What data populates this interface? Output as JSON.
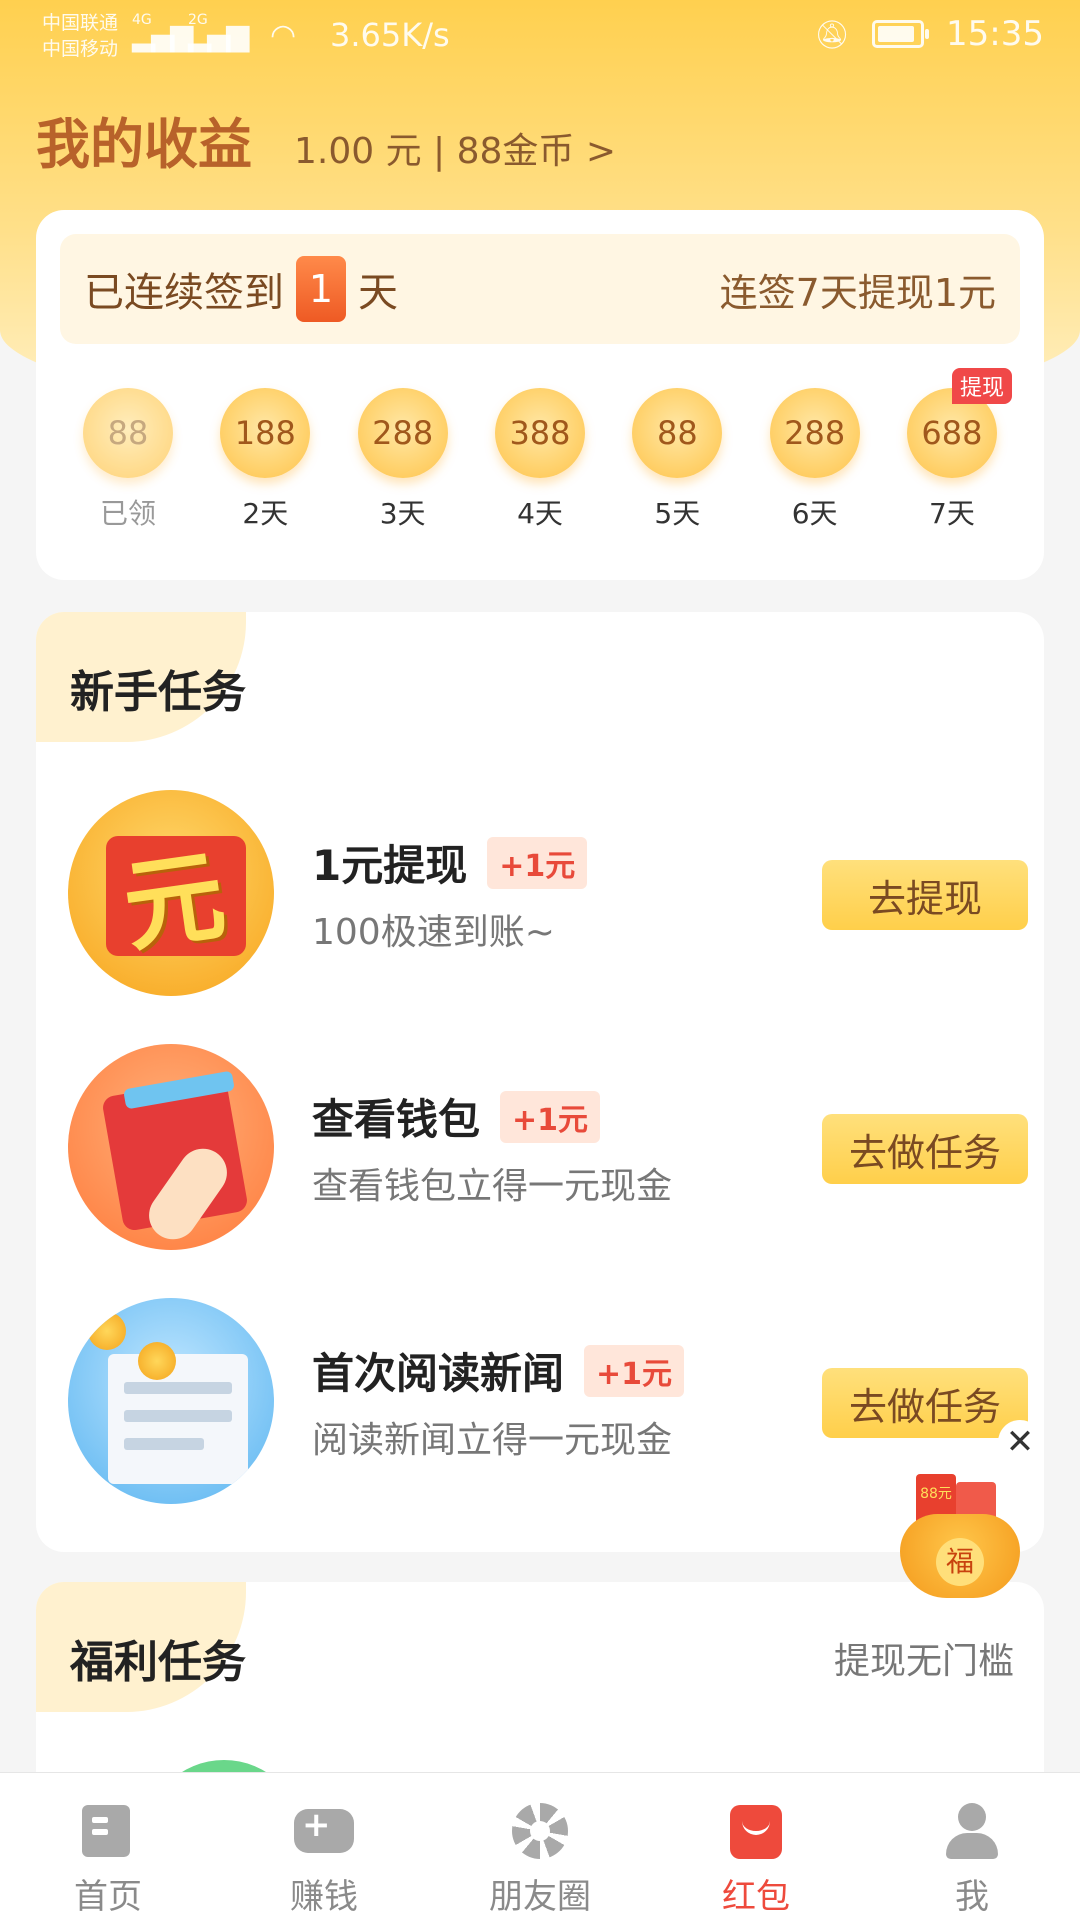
{
  "status_bar": {
    "carrier_1": "中国联通",
    "carrier_2": "中国移动",
    "signal_1_type": "4G",
    "signal_2_type": "2G",
    "speed": "3.65K/s",
    "time": "15:35",
    "icons": [
      "signal-icon",
      "wifi-icon",
      "mute-icon",
      "battery-icon"
    ]
  },
  "header": {
    "title": "我的收益",
    "earnings": "1.00 元 | 88金币 >"
  },
  "checkin": {
    "prefix": "已连续签到",
    "days": "1",
    "suffix": "天",
    "goal": "连签7天提现1元",
    "withdraw_tag": "提现",
    "days_list": [
      {
        "coins": "88",
        "label": "已领",
        "claimed": true
      },
      {
        "coins": "188",
        "label": "2天",
        "claimed": false
      },
      {
        "coins": "288",
        "label": "3天",
        "claimed": false
      },
      {
        "coins": "388",
        "label": "4天",
        "claimed": false
      },
      {
        "coins": "88",
        "label": "5天",
        "claimed": false
      },
      {
        "coins": "288",
        "label": "6天",
        "claimed": false
      },
      {
        "coins": "688",
        "label": "7天",
        "claimed": false
      }
    ]
  },
  "newbie_tasks": {
    "title": "新手任务",
    "items": [
      {
        "title": "1元提现",
        "reward": "+1元",
        "desc": "100极速到账~",
        "button": "去提现",
        "icon": "yuan-envelope-icon",
        "icon_glyph": "元"
      },
      {
        "title": "查看钱包",
        "reward": "+1元",
        "desc": "查看钱包立得一元现金",
        "button": "去做任务",
        "icon": "wallet-icon"
      },
      {
        "title": "首次阅读新闻",
        "reward": "+1元",
        "desc": "阅读新闻立得一元现金",
        "button": "去做任务",
        "icon": "newspaper-icon"
      }
    ]
  },
  "floating_widget": {
    "close": "✕",
    "pot_char": "福",
    "envelope_text": "88元"
  },
  "welfare_tasks": {
    "title": "福利任务",
    "hint": "提现无门槛"
  },
  "bottom_nav": {
    "items": [
      {
        "label": "首页",
        "icon": "home-icon",
        "active": false
      },
      {
        "label": "赚钱",
        "icon": "gamepad-icon",
        "active": false
      },
      {
        "label": "朋友圈",
        "icon": "moments-icon",
        "active": false
      },
      {
        "label": "红包",
        "icon": "red-packet-icon",
        "active": true
      },
      {
        "label": "我",
        "icon": "profile-icon",
        "active": false
      }
    ]
  },
  "colors": {
    "accent": "#ffcf4a",
    "title_brown": "#b8622a",
    "reward_red": "#e84a3a",
    "nav_active": "#ee4a3c"
  }
}
